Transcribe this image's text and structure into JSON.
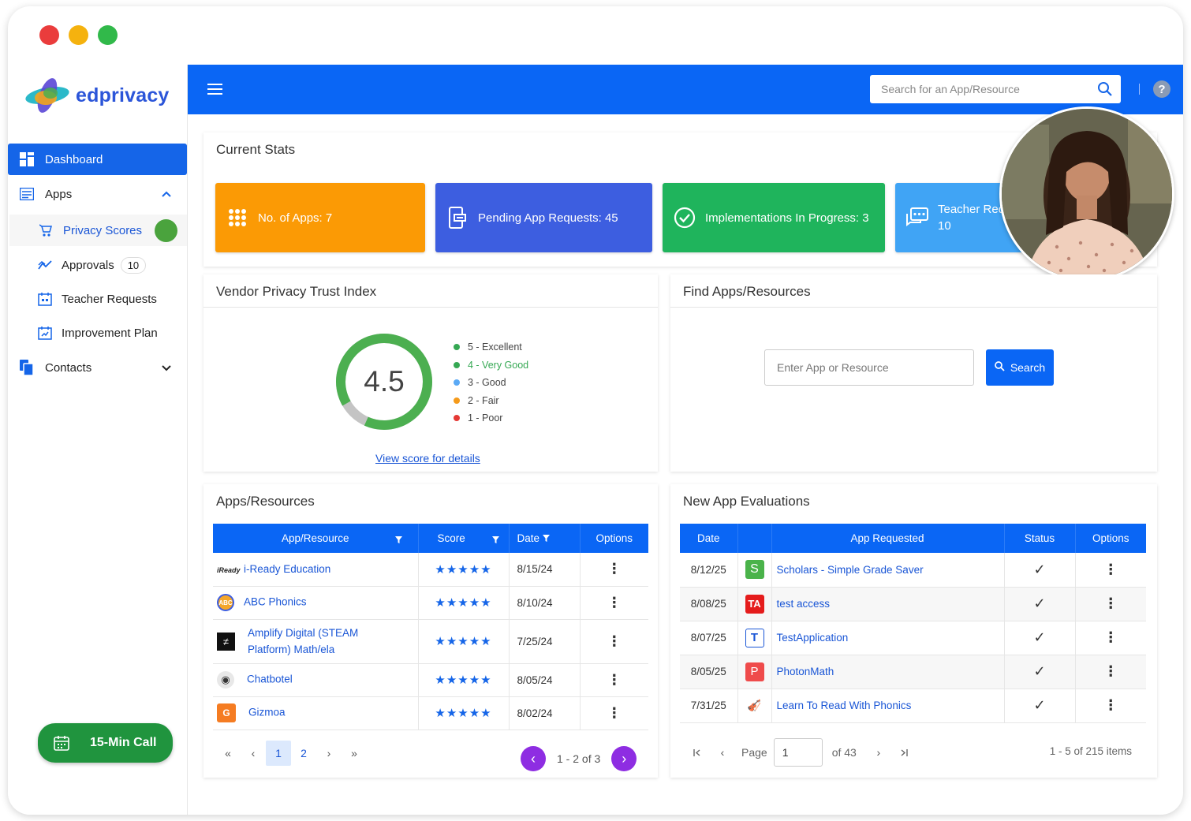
{
  "window": {
    "traffic_colors": [
      "#ea3c3c",
      "#f5b20e",
      "#31b94a"
    ]
  },
  "brand": {
    "name": "edprivacy"
  },
  "sidebar": {
    "items": [
      {
        "label": "Dashboard",
        "icon": "dashboard-icon"
      },
      {
        "label": "Apps",
        "icon": "apps-icon"
      },
      {
        "label": "Privacy Scores",
        "icon": "privacy-scores-icon"
      },
      {
        "label": "Approvals",
        "icon": "approvals-icon",
        "badge": "10"
      },
      {
        "label": "Teacher Requests",
        "icon": "teacher-requests-icon"
      },
      {
        "label": "Improvement Plan",
        "icon": "improvement-plan-icon"
      },
      {
        "label": "Contacts",
        "icon": "contacts-icon"
      }
    ],
    "call_button": "15-Min Call"
  },
  "topbar": {
    "search_placeholder": "Search for an App/Resource",
    "help": "?"
  },
  "stats": {
    "title": "Current Stats",
    "cards": [
      {
        "label": "No. of Apps: 7",
        "color": "#fb9a05"
      },
      {
        "label": "Pending App Requests: 45",
        "color": "#3d5ee0"
      },
      {
        "label": "Implementations In Progress: 3",
        "color": "#1fb45c"
      },
      {
        "label": "Teacher Req",
        "value": "10",
        "color": "#40a4f5"
      }
    ]
  },
  "trust": {
    "title": "Vendor Privacy Trust Index",
    "score": "4.5",
    "score_fraction": 0.9,
    "legend": [
      {
        "label": "5 - Excellent",
        "color": "#35a853"
      },
      {
        "label": "4 - Very Good",
        "color": "#35a853"
      },
      {
        "label": "3 - Good",
        "color": "#5aa9f5"
      },
      {
        "label": "2 - Fair",
        "color": "#f59a1a"
      },
      {
        "label": "1 - Poor",
        "color": "#e53935"
      }
    ],
    "link": "View score for details"
  },
  "find": {
    "title": "Find Apps/Resources",
    "placeholder": "Enter App or Resource",
    "button": "Search"
  },
  "apps": {
    "title": "Apps/Resources",
    "headers": [
      "App/Resource",
      "Score",
      "Date",
      "Options"
    ],
    "rows": [
      {
        "name": "i-Ready Education",
        "logo": "iReady",
        "stars": "★★★★★",
        "date": "8/15/24"
      },
      {
        "name": "ABC Phonics",
        "logo": "ABC",
        "stars": "★★★★★",
        "date": "8/10/24"
      },
      {
        "name": "Amplify Digital (STEAM",
        "name2": "Platform) Math/ela",
        "logo": "≠",
        "stars": "★★★★★",
        "date": "7/25/24"
      },
      {
        "name": "Chatbotel",
        "logo": "◉",
        "stars": "★★★★★",
        "date": "8/05/24"
      },
      {
        "name": "Gizmoa",
        "logo": "G",
        "stars": "★★★★★",
        "date": "8/02/24"
      }
    ],
    "pager": {
      "first": "«",
      "prev": "‹",
      "pages": [
        "1",
        "2"
      ],
      "next": "›",
      "last": "»",
      "range": "1 - 2 of 3"
    }
  },
  "evals": {
    "title": "New App Evaluations",
    "headers": [
      "Date",
      "App Requested",
      "Status",
      "Options"
    ],
    "rows": [
      {
        "date": "8/12/25",
        "logo": "S",
        "logo_color": "#4ab34a",
        "name": "Scholars - Simple Grade Saver"
      },
      {
        "date": "8/08/25",
        "logo": "TA",
        "logo_color": "#e51c1c",
        "name": "test access"
      },
      {
        "date": "8/07/25",
        "logo": "T",
        "logo_color": "#ffffff",
        "name": "TestApplication"
      },
      {
        "date": "8/05/25",
        "logo": "P",
        "logo_color": "#ef4b4b",
        "name": "PhotonMath"
      },
      {
        "date": "7/31/25",
        "logo": "🎻",
        "logo_color": "#ffffff",
        "name": "Learn To Read With Phonics"
      }
    ],
    "pager": {
      "page_label": "Page",
      "page_value": "1",
      "of": "of 43",
      "items": "1 - 5 of 215 items"
    }
  }
}
